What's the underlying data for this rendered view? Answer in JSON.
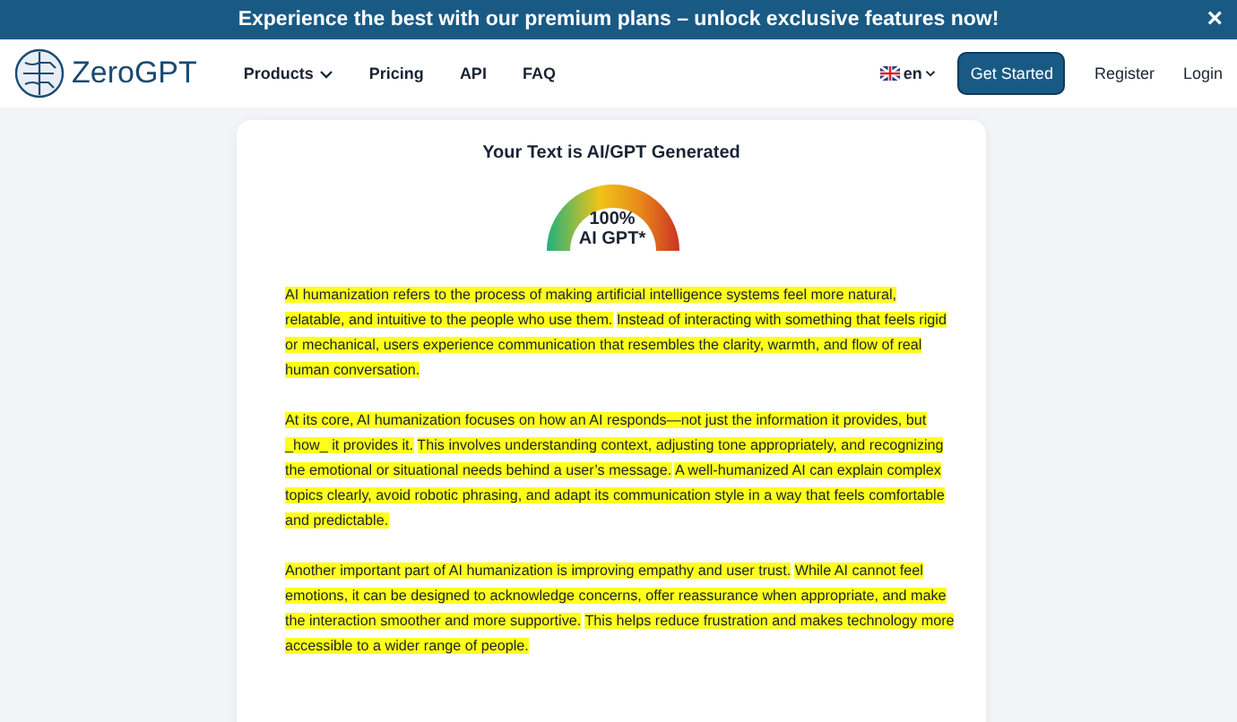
{
  "banner": {
    "text": "Experience the best with our premium plans – unlock exclusive features now!",
    "close": "×"
  },
  "nav": {
    "logo": "ZeroGPT",
    "links": [
      {
        "label": "Products",
        "dropdown": true
      },
      {
        "label": "Pricing",
        "dropdown": false
      },
      {
        "label": "API",
        "dropdown": false
      },
      {
        "label": "FAQ",
        "dropdown": false
      }
    ],
    "language": "en",
    "cta": "Get Started",
    "register": "Register",
    "login": "Login"
  },
  "result": {
    "title": "Your Text is AI/GPT Generated",
    "gauge": {
      "percent": "100%",
      "label": "AI GPT*"
    },
    "paragraphs": [
      {
        "sentences": [
          {
            "text": "AI humanization refers to the process of making artificial intelligence systems feel more natural, relatable, and intuitive to the people who use them.",
            "highlighted": true
          },
          {
            "text": "Instead of interacting with something that feels rigid or mechanical, users experience communication that resembles the clarity, warmth, and flow of real human conversation.",
            "highlighted": true
          }
        ]
      },
      {
        "sentences": [
          {
            "text": "At its core, AI humanization focuses on how an AI responds—not just the information it provides, but _how_ it provides it.",
            "highlighted": true
          },
          {
            "text": "This involves understanding context, adjusting tone appropriately, and recognizing the emotional or situational needs behind a user’s message.",
            "highlighted": true
          },
          {
            "text": "A well-humanized AI can explain complex topics clearly, avoid robotic phrasing, and adapt its communication style in a way that feels comfortable and predictable.",
            "highlighted": true
          }
        ]
      },
      {
        "sentences": [
          {
            "text": "Another important part of AI humanization is improving empathy and user trust.",
            "highlighted": true
          },
          {
            "text": "While AI cannot feel emotions, it can be designed to acknowledge concerns, offer reassurance when appropriate, and make the interaction smoother and more supportive.",
            "highlighted": true
          },
          {
            "text": "This helps reduce frustration and makes technology more accessible to a wider range of people.",
            "highlighted": true
          }
        ]
      }
    ]
  }
}
